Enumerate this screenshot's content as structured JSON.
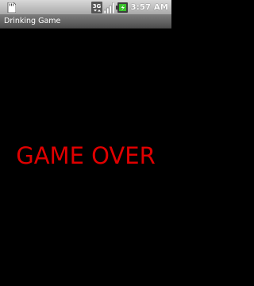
{
  "status_bar": {
    "time": "3:57 AM",
    "icons": [
      "sd-card-icon",
      "3g-data-icon",
      "signal-icon",
      "battery-icon"
    ]
  },
  "title_bar": {
    "title": "Drinking Game"
  },
  "content": {
    "message": "GAME OVER"
  },
  "colors": {
    "background": "#000000",
    "message": "#e00000",
    "title_bar": "#5a5a5a",
    "status_bar": "#bdbdbd"
  }
}
